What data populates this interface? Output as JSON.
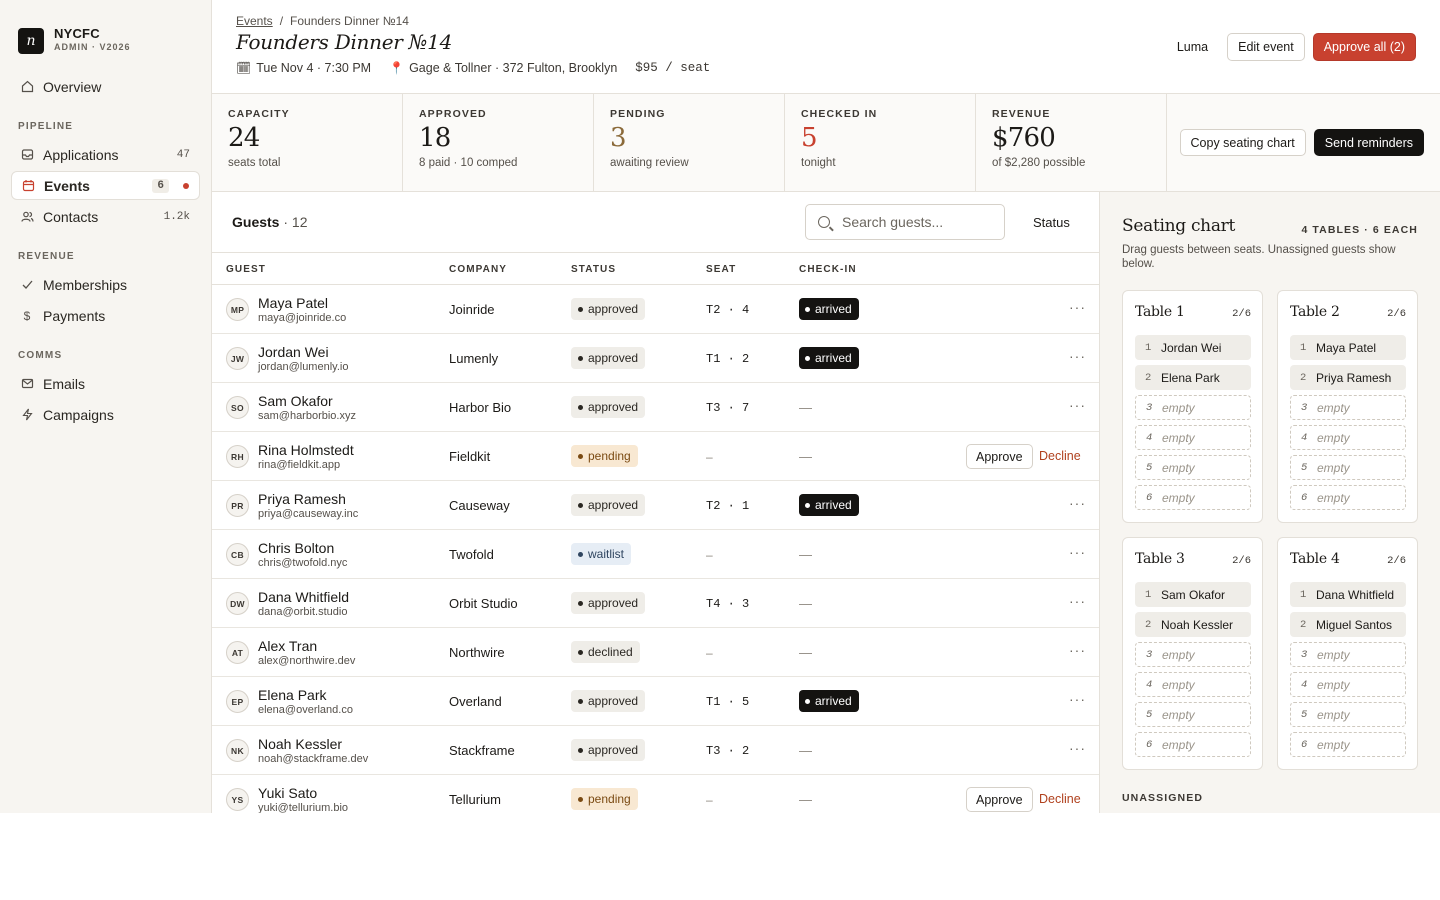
{
  "brand": {
    "mark": "n",
    "name": "NYCFC",
    "sub": "ADMIN · V2026"
  },
  "sidebar": {
    "overview": "Overview",
    "sections": [
      "PIPELINE",
      "REVENUE",
      "COMMS"
    ],
    "pipeline": [
      {
        "label": "Applications",
        "count": "47",
        "icon": "inbox-icon"
      },
      {
        "label": "Events",
        "count": "6",
        "icon": "calendar-icon",
        "active": true
      },
      {
        "label": "Contacts",
        "count": "1.2k",
        "icon": "people-icon"
      }
    ],
    "revenue": [
      {
        "label": "Memberships",
        "icon": "check-icon"
      },
      {
        "label": "Payments",
        "icon": "dollar-icon"
      }
    ],
    "comms": [
      {
        "label": "Emails",
        "icon": "mail-icon"
      },
      {
        "label": "Campaigns",
        "icon": "bolt-icon"
      }
    ]
  },
  "header": {
    "breadcrumb_root": "Events",
    "breadcrumb_sep": "/",
    "breadcrumb_current": "Founders Dinner №14",
    "title": "Founders Dinner №14",
    "date": "Tue Nov 4 · 7:30 PM",
    "location": "Gage & Tollner · 372 Fulton, Brooklyn",
    "price": "$95 / seat",
    "actions": {
      "luma": "Luma",
      "edit": "Edit event",
      "approve_all": "Approve all (2)"
    }
  },
  "stats": [
    {
      "label": "CAPACITY",
      "value": "24",
      "sub": "seats total",
      "style": ""
    },
    {
      "label": "APPROVED",
      "value": "18",
      "sub": "8 paid · 10 comped",
      "style": ""
    },
    {
      "label": "PENDING",
      "value": "3",
      "sub": "awaiting review",
      "style": "pending"
    },
    {
      "label": "CHECKED IN",
      "value": "5",
      "sub": "tonight",
      "style": "red"
    },
    {
      "label": "REVENUE",
      "value": "$760",
      "sub": "of $2,280 possible",
      "style": ""
    }
  ],
  "stat_actions": {
    "copy": "Copy seating chart",
    "remind": "Send reminders"
  },
  "guests": {
    "title": "Guests",
    "count": "· 12",
    "search_placeholder": "Search guests...",
    "status_filter": "Status",
    "columns": [
      "GUEST",
      "COMPANY",
      "STATUS",
      "SEAT",
      "CHECK-IN"
    ],
    "approve_label": "Approve",
    "decline_label": "Decline",
    "rows": [
      {
        "initials": "MP",
        "name": "Maya Patel",
        "email": "maya@joinride.co",
        "company": "Joinride",
        "status": "approved",
        "seat": "T2 · 4",
        "checkin": "arrived"
      },
      {
        "initials": "JW",
        "name": "Jordan Wei",
        "email": "jordan@lumenly.io",
        "company": "Lumenly",
        "status": "approved",
        "seat": "T1 · 2",
        "checkin": "arrived"
      },
      {
        "initials": "SO",
        "name": "Sam Okafor",
        "email": "sam@harborbio.xyz",
        "company": "Harbor Bio",
        "status": "approved",
        "seat": "T3 · 7",
        "checkin": "—"
      },
      {
        "initials": "RH",
        "name": "Rina Holmstedt",
        "email": "rina@fieldkit.app",
        "company": "Fieldkit",
        "status": "pending",
        "seat": "–",
        "checkin": "—"
      },
      {
        "initials": "PR",
        "name": "Priya Ramesh",
        "email": "priya@causeway.inc",
        "company": "Causeway",
        "status": "approved",
        "seat": "T2 · 1",
        "checkin": "arrived"
      },
      {
        "initials": "CB",
        "name": "Chris Bolton",
        "email": "chris@twofold.nyc",
        "company": "Twofold",
        "status": "waitlist",
        "seat": "–",
        "checkin": "—"
      },
      {
        "initials": "DW",
        "name": "Dana Whitfield",
        "email": "dana@orbit.studio",
        "company": "Orbit Studio",
        "status": "approved",
        "seat": "T4 · 3",
        "checkin": "—"
      },
      {
        "initials": "AT",
        "name": "Alex Tran",
        "email": "alex@northwire.dev",
        "company": "Northwire",
        "status": "declined",
        "seat": "–",
        "checkin": "—"
      },
      {
        "initials": "EP",
        "name": "Elena Park",
        "email": "elena@overland.co",
        "company": "Overland",
        "status": "approved",
        "seat": "T1 · 5",
        "checkin": "arrived"
      },
      {
        "initials": "NK",
        "name": "Noah Kessler",
        "email": "noah@stackframe.dev",
        "company": "Stackframe",
        "status": "approved",
        "seat": "T3 · 2",
        "checkin": "—"
      },
      {
        "initials": "YS",
        "name": "Yuki Sato",
        "email": "yuki@tellurium.bio",
        "company": "Tellurium",
        "status": "pending",
        "seat": "–",
        "checkin": "—"
      }
    ]
  },
  "seating": {
    "title": "Seating chart",
    "meta": "4 TABLES · 6 EACH",
    "desc": "Drag guests between seats. Unassigned guests show below.",
    "empty_label": "empty",
    "unassigned": "UNASSIGNED",
    "tables": [
      {
        "name": "Table 1",
        "count": "2/6",
        "seats": [
          "Jordan Wei",
          "Elena Park",
          "",
          "",
          "",
          ""
        ]
      },
      {
        "name": "Table 2",
        "count": "2/6",
        "seats": [
          "Maya Patel",
          "Priya Ramesh",
          "",
          "",
          "",
          ""
        ]
      },
      {
        "name": "Table 3",
        "count": "2/6",
        "seats": [
          "Sam Okafor",
          "Noah Kessler",
          "",
          "",
          "",
          ""
        ]
      },
      {
        "name": "Table 4",
        "count": "2/6",
        "seats": [
          "Dana Whitfield",
          "Miguel Santos",
          "",
          "",
          "",
          ""
        ]
      }
    ]
  },
  "colors": {
    "accent": "#c8412f",
    "dark": "#141311",
    "sidebar_bg": "#f7f5f1"
  }
}
